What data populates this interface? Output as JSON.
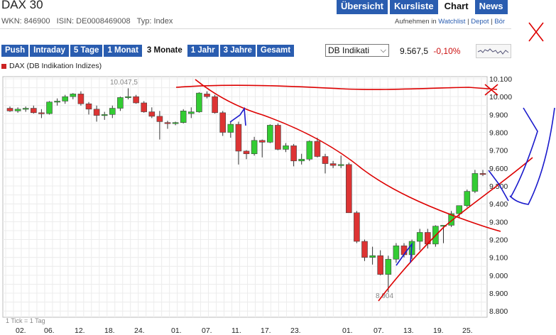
{
  "header": {
    "title": "DAX 30",
    "tabs": [
      {
        "label": "Übersicht"
      },
      {
        "label": "Kursliste"
      },
      {
        "label": "Chart"
      },
      {
        "label": "News"
      }
    ]
  },
  "meta": {
    "wkn": "WKN: 846900",
    "isin": "ISIN: DE0008469008",
    "type": "Typ: Index"
  },
  "actions": {
    "add": "Aufnehmen in",
    "watchlist": "Watchlist",
    "sep": " | ",
    "depot": "Depot",
    "sep2": " | ",
    "boerse": "Bör"
  },
  "periods": [
    {
      "label": "Push"
    },
    {
      "label": "Intraday"
    },
    {
      "label": "5 Tage"
    },
    {
      "label": "1 Monat"
    },
    {
      "label": "3 Monate"
    },
    {
      "label": "1 Jahr"
    },
    {
      "label": "3 Jahre"
    },
    {
      "label": "Gesamt"
    }
  ],
  "exchange_select": {
    "value": "DB Indikati"
  },
  "quote": {
    "price": "9.567,5",
    "change": "-0,10%"
  },
  "legend": {
    "label": "DAX (DB Indikation Indizes)"
  },
  "footnote": "1 Tick = 1 Tag",
  "colors": {
    "up": "#33cc33",
    "down": "#dd3333",
    "accent": "#2a5db0",
    "annotation_red": "#dd0000",
    "annotation_blue": "#1a1acc"
  },
  "chart_data": {
    "type": "candlestick",
    "y_ticks": [
      "10.100",
      "10.000",
      "9.900",
      "9.800",
      "9.700",
      "9.600",
      "9.500",
      "9.400",
      "9.300",
      "9.200",
      "9.100",
      "9.000",
      "8.900",
      "8.800"
    ],
    "ylim": [
      8760,
      10110
    ],
    "x_ticks": [
      "02.",
      "06.",
      "12.",
      "18.",
      "24.",
      "01.",
      "07.",
      "11.",
      "17.",
      "23.",
      "01.",
      "07.",
      "13.",
      "19.",
      "25."
    ],
    "annotations": {
      "high": "10.047,5",
      "low": "8.904"
    },
    "candles": [
      [
        9935,
        9945,
        9915,
        9920
      ],
      [
        9920,
        9940,
        9910,
        9930
      ],
      [
        9930,
        9945,
        9915,
        9935
      ],
      [
        9935,
        9950,
        9905,
        9910
      ],
      [
        9910,
        9930,
        9880,
        9905
      ],
      [
        9905,
        9975,
        9900,
        9970
      ],
      [
        9970,
        9990,
        9950,
        9975
      ],
      [
        9975,
        10010,
        9960,
        10000
      ],
      [
        10000,
        10020,
        9985,
        10015
      ],
      [
        10015,
        10030,
        9950,
        9960
      ],
      [
        9960,
        9970,
        9900,
        9930
      ],
      [
        9930,
        9950,
        9860,
        9895
      ],
      [
        9895,
        9915,
        9870,
        9900
      ],
      [
        9900,
        9950,
        9880,
        9935
      ],
      [
        9935,
        10000,
        9920,
        9995
      ],
      [
        9995,
        10047,
        9985,
        10000
      ],
      [
        10000,
        10010,
        9960,
        9965
      ],
      [
        9965,
        9975,
        9910,
        9915
      ],
      [
        9915,
        9940,
        9880,
        9890
      ],
      [
        9890,
        9920,
        9760,
        9860
      ],
      [
        9855,
        9865,
        9820,
        9850
      ],
      [
        9850,
        9860,
        9840,
        9855
      ],
      [
        9855,
        9930,
        9850,
        9920
      ],
      [
        9905,
        9940,
        9880,
        9915
      ],
      [
        9915,
        10025,
        9910,
        10020
      ],
      [
        10015,
        10030,
        9990,
        10000
      ],
      [
        10000,
        10010,
        9905,
        9910
      ],
      [
        9910,
        9920,
        9780,
        9800
      ],
      [
        9800,
        9860,
        9770,
        9845
      ],
      [
        9845,
        9860,
        9620,
        9695
      ],
      [
        9695,
        9700,
        9650,
        9680
      ],
      [
        9680,
        9775,
        9670,
        9755
      ],
      [
        9755,
        9760,
        9660,
        9745
      ],
      [
        9745,
        9845,
        9740,
        9840
      ],
      [
        9840,
        9850,
        9700,
        9705
      ],
      [
        9705,
        9740,
        9690,
        9725
      ],
      [
        9725,
        9735,
        9610,
        9640
      ],
      [
        9640,
        9680,
        9620,
        9650
      ],
      [
        9650,
        9755,
        9640,
        9750
      ],
      [
        9750,
        9770,
        9660,
        9665
      ],
      [
        9665,
        9680,
        9570,
        9625
      ],
      [
        9625,
        9640,
        9600,
        9615
      ],
      [
        9615,
        9670,
        9600,
        9620
      ],
      [
        9620,
        9630,
        9350,
        9350
      ],
      [
        9350,
        9360,
        9180,
        9190
      ],
      [
        9190,
        9200,
        9080,
        9100
      ],
      [
        9100,
        9160,
        9060,
        9110
      ],
      [
        9110,
        9140,
        9000,
        9005
      ],
      [
        9005,
        9110,
        8904,
        9090
      ],
      [
        9090,
        9180,
        9070,
        9165
      ],
      [
        9165,
        9180,
        9100,
        9115
      ],
      [
        9115,
        9200,
        9090,
        9190
      ],
      [
        9190,
        9260,
        9140,
        9240
      ],
      [
        9240,
        9260,
        9150,
        9175
      ],
      [
        9175,
        9280,
        9160,
        9275
      ],
      [
        9275,
        9280,
        9180,
        9280
      ],
      [
        9280,
        9360,
        9270,
        9345
      ],
      [
        9345,
        9390,
        9320,
        9390
      ],
      [
        9390,
        9480,
        9380,
        9470
      ],
      [
        9470,
        9590,
        9460,
        9570
      ],
      [
        9570,
        9590,
        9555,
        9567
      ]
    ]
  }
}
